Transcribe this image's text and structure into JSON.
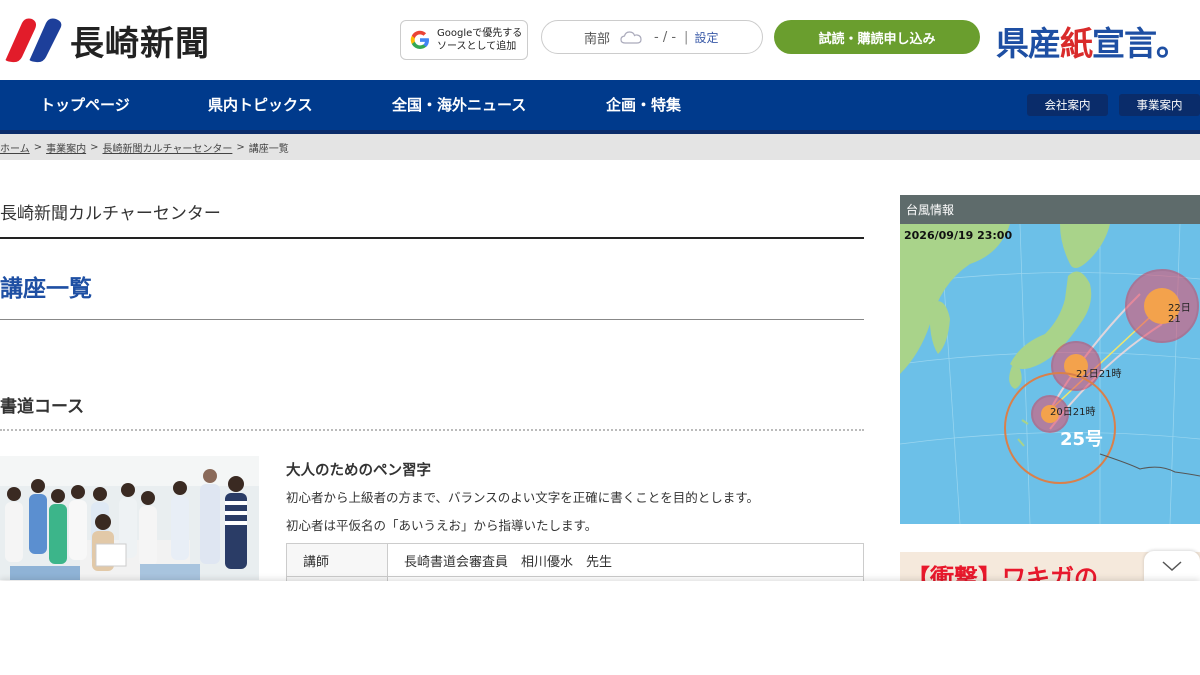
{
  "header": {
    "logo_text": "長崎新聞",
    "google_line1": "Googleで優先する",
    "google_line2": "ソースとして追加",
    "weather_region": "南部",
    "weather_temp": "- / -",
    "weather_sep": "|",
    "weather_settings": "設定",
    "subscribe": "試読・購読申し込み",
    "sengen_a": "県産",
    "sengen_b": "紙",
    "sengen_c": "宣言。"
  },
  "nav": {
    "items": [
      "トップページ",
      "県内トピックス",
      "全国・海外ニュース",
      "企画・特集"
    ],
    "company": "会社案内",
    "business": "事業案内"
  },
  "breadcrumb": [
    "ホーム",
    "事業案内",
    "長崎新聞カルチャーセンター",
    "講座一覧"
  ],
  "main": {
    "section_title": "長崎新聞カルチャーセンター",
    "page_title": "講座一覧",
    "course_head": "書道コース",
    "course": {
      "name": "大人のためのペン習字",
      "desc1": "初心者から上級者の方まで、バランスのよい文字を正確に書くことを目的とします。",
      "desc2": "初心者は平仮名の「あいうえお」から指導いたします。",
      "table": [
        {
          "key": "講師",
          "value": "長崎書道会審査員　相川優水　先生"
        },
        {
          "key": "",
          "value": ""
        }
      ]
    }
  },
  "sidebar": {
    "typhoon_title": "台風情報",
    "map_datetime": "2026/09/19 23:00",
    "labels": [
      "22日21",
      "21日21時",
      "20日21時",
      "25号"
    ],
    "ad_text": "【衝撃】ワキガの"
  },
  "colors": {
    "nav_bg": "#003a8c",
    "brand_blue": "#1e4fa3",
    "subscribe_green": "#6a9e2e",
    "accent_red": "#d92b2b"
  }
}
